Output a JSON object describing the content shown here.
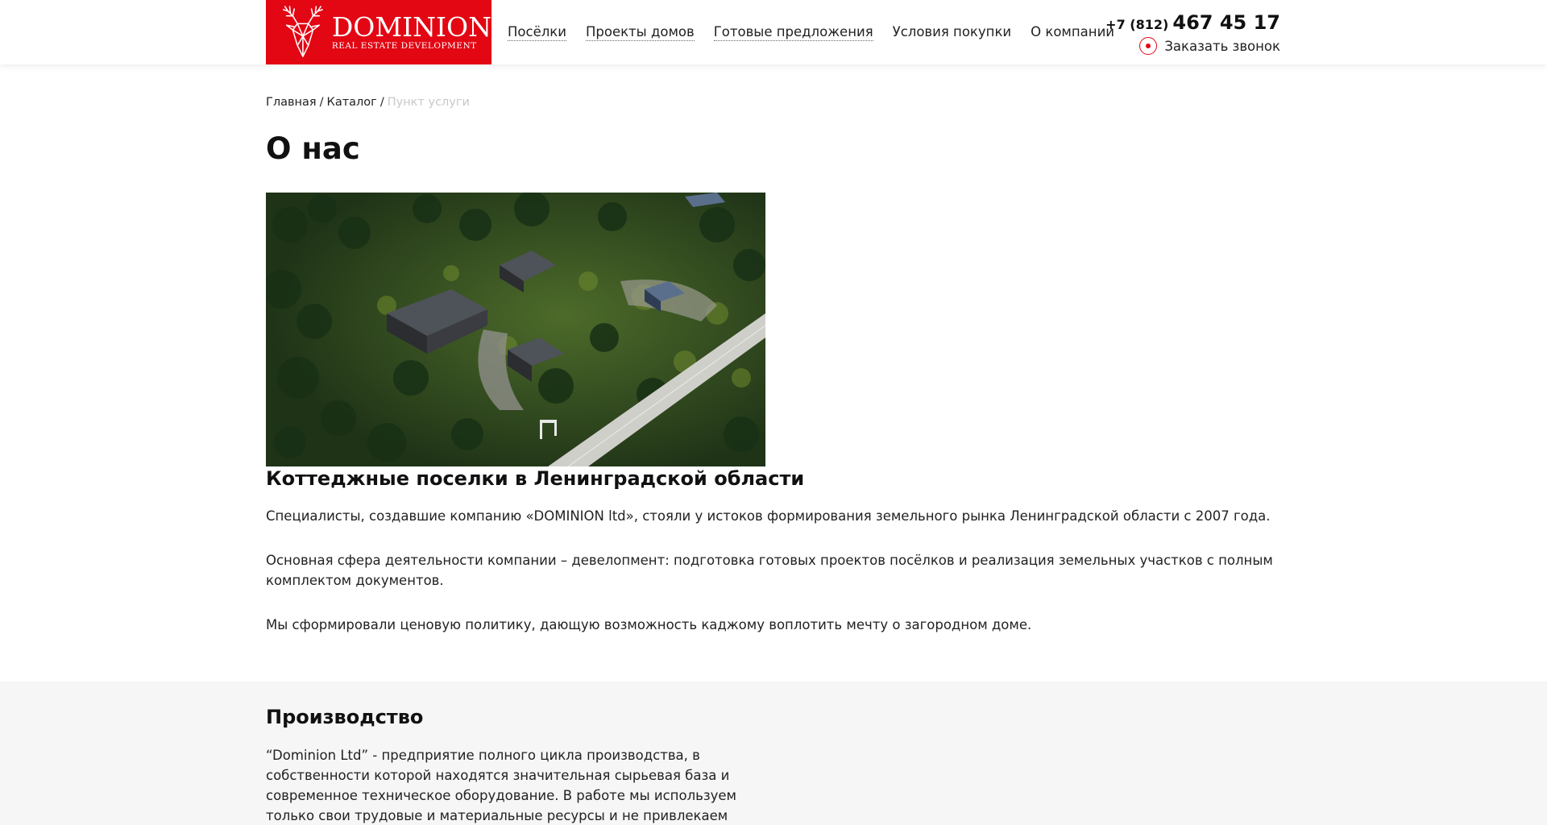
{
  "header": {
    "logo": {
      "title": "DOMINION",
      "subtitle": "REAL ESTATE DEVELOPMENT",
      "icon": "deer-head-icon"
    },
    "nav": [
      {
        "label": "Посёлки"
      },
      {
        "label": "Проекты домов"
      },
      {
        "label": "Готовые предложения"
      },
      {
        "label": "Условия покупки"
      },
      {
        "label": "О компании"
      }
    ],
    "phone_prefix": "+7 (812)",
    "phone_number": "467 45 17",
    "callback_label": "Заказать звонок"
  },
  "breadcrumb": {
    "items": [
      "Главная",
      "Каталог"
    ],
    "separator": "/",
    "current": "Пункт услуги"
  },
  "page_title": "О нас",
  "hero_image": {
    "description": "aerial-forest-cottages"
  },
  "section": {
    "title": "Коттеджные поселки в Ленинградской области",
    "paragraphs": [
      "Специалисты, создавшие компанию «DOMINION ltd», стояли у истоков формирования земельного рынка Ленинградской области с 2007 года.",
      "Основная сфера деятельности компании – девелопмент: подготовка готовых проектов посёлков и реализация земельных участков с полным комплектом документов.",
      "Мы сформировали ценовую политику, дающую возможность каджому воплотить мечту о загородном доме."
    ]
  },
  "production": {
    "title": "Производство",
    "text": "“Dominion Ltd” - предприятие полного цикла производства, в собственности которой находятся значительная сырьевая база и современное техническое оборудование. В работе мы используем только свои трудовые и материальные ресурсы и не привлекаем"
  },
  "colors": {
    "brand": "#e30613",
    "text": "#222222",
    "muted": "#c8c8c8",
    "section_bg": "#f6f6f6"
  }
}
